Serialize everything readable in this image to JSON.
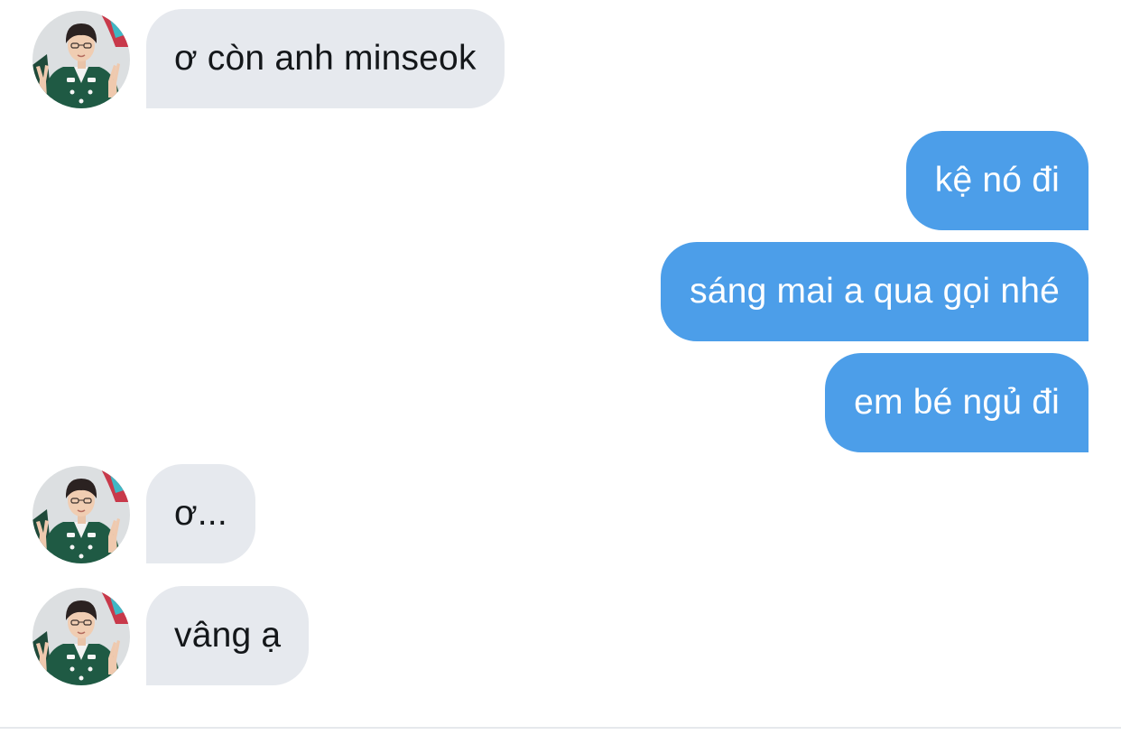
{
  "messages": [
    {
      "direction": "incoming",
      "text": "ơ còn anh minseok",
      "avatar": "contact-avatar"
    },
    {
      "direction": "outgoing",
      "text": "kệ nó đi"
    },
    {
      "direction": "outgoing",
      "text": "sáng mai a qua gọi nhé"
    },
    {
      "direction": "outgoing",
      "text": "em bé ngủ đi"
    },
    {
      "direction": "incoming",
      "text": "ơ...",
      "avatar": "contact-avatar"
    },
    {
      "direction": "incoming",
      "text": "vâng ạ",
      "avatar": "contact-avatar"
    }
  ],
  "colors": {
    "incoming_bubble": "#e6e9ee",
    "outgoing_bubble": "#4c9ee9",
    "incoming_text": "#14171a",
    "outgoing_text": "#ffffff"
  }
}
